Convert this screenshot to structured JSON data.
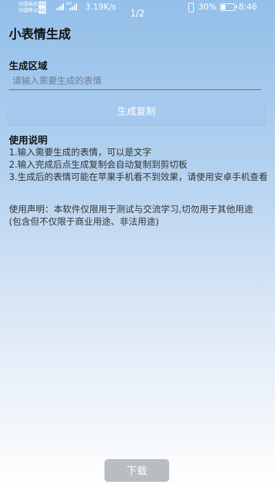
{
  "status_bar": {
    "carrier_1": "中国电信",
    "carrier_2": "中国移动",
    "hd_badge": "HD",
    "network_type": "4G",
    "speed": "3.19K/s",
    "page_counter": "1/2",
    "battery_percent": "30%",
    "battery_level": 0.3,
    "time": "8:46",
    "icons": [
      "signal-icon",
      "vibrate-icon",
      "battery-icon"
    ]
  },
  "app": {
    "title": "小表情生成"
  },
  "generate_section": {
    "label": "生成区域",
    "input_value": "",
    "input_placeholder": "请输入需要生成的表情",
    "button_label": "生成复制"
  },
  "instructions": {
    "title": "使用说明",
    "items": [
      "1.输入需要生成的表情，可以是文字",
      "2.输入完成后点生成复制会自动复制到剪切板",
      "3.生成后的表情可能在苹果手机看不到效果，请使用安卓手机查看"
    ],
    "disclaimer": "使用声明：本软件仅限用于测试与交流学习,切勿用于其他用途(包含但不仅限于商业用途、非法用途)"
  },
  "footer": {
    "download_label": "下载"
  },
  "colors": {
    "background_top": "#93bfe9",
    "background_bottom": "#ffffff",
    "primary_button": "#a5c8ef",
    "download_button": "#b9bcc0"
  }
}
